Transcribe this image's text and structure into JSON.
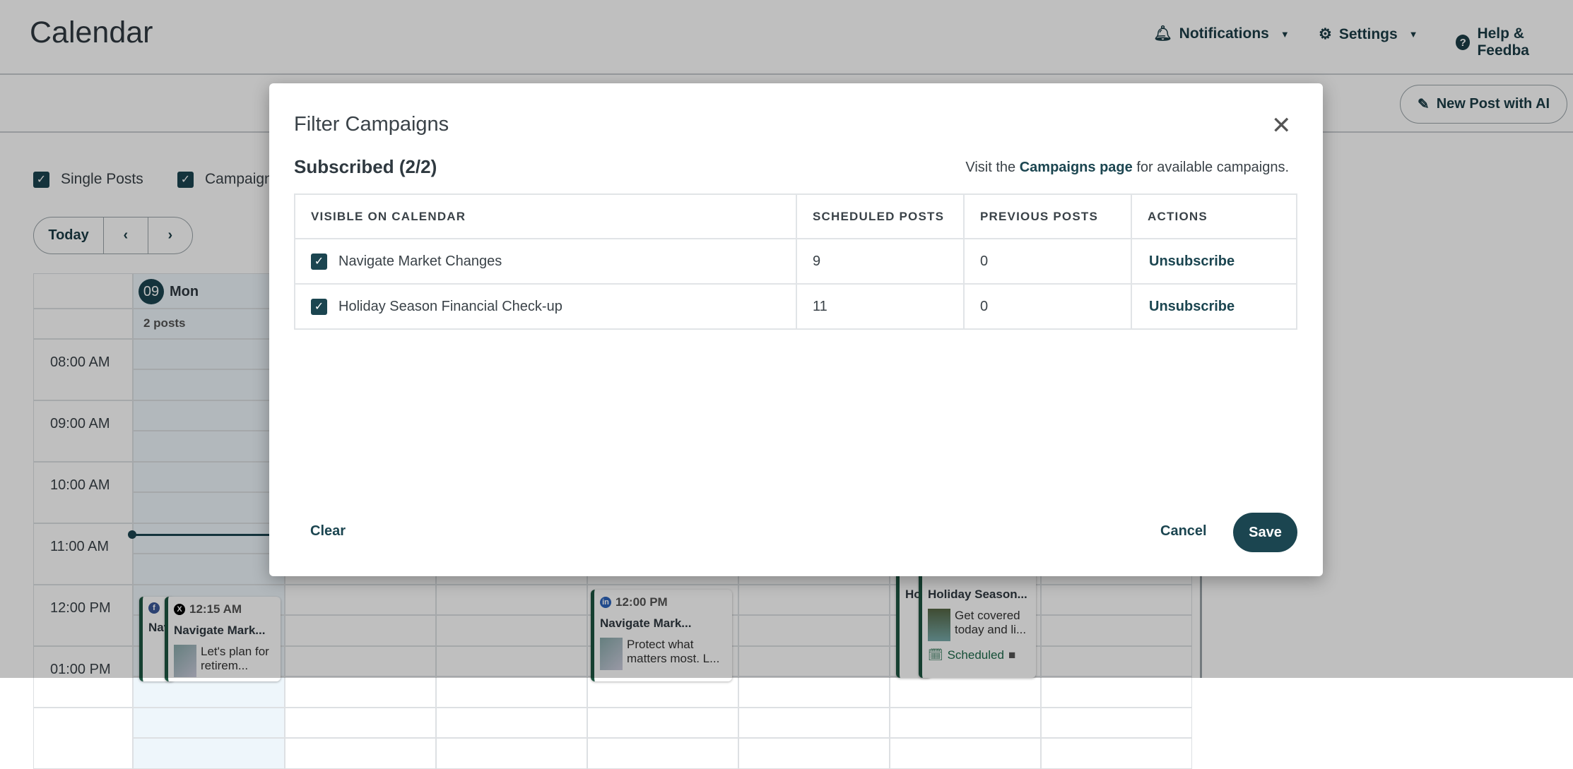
{
  "header": {
    "title": "Calendar",
    "notifications": "Notifications",
    "settings": "Settings",
    "help": "Help & Feedba"
  },
  "toolbar": {
    "new_post": "New Post with AI"
  },
  "filters": {
    "single_posts": "Single Posts",
    "campaigns": "Campaign"
  },
  "nav": {
    "today": "Today",
    "prev": "‹",
    "next": "›"
  },
  "calendar": {
    "day_num": "09",
    "day_name": "Mon",
    "posts_count": "2 posts",
    "times": [
      "08:00 AM",
      "09:00 AM",
      "10:00 AM",
      "11:00 AM",
      "12:00 PM",
      "01:00 PM"
    ],
    "posts": [
      {
        "time": "12:15 AM",
        "title": "Navigate Mark...",
        "text": "Let's plan for retirem...",
        "network": "X"
      },
      {
        "title": "Nav",
        "network": "f"
      },
      {
        "time": "12:00 PM",
        "title": "Navigate Mark...",
        "text": "Protect what matters most. L...",
        "network": "in"
      },
      {
        "title": "Holiday Season...",
        "text": "Get covered today and li...",
        "status": "Scheduled"
      },
      {
        "title": "Ho"
      }
    ]
  },
  "modal": {
    "title": "Filter Campaigns",
    "subscribed": "Subscribed (2/2)",
    "hint_pre": "Visit the ",
    "hint_link": "Campaigns page",
    "hint_post": " for available campaigns.",
    "columns": [
      "VISIBLE ON CALENDAR",
      "SCHEDULED POSTS",
      "PREVIOUS POSTS",
      "ACTIONS"
    ],
    "rows": [
      {
        "name": "Navigate Market Changes",
        "scheduled": "9",
        "previous": "0",
        "action": "Unsubscribe",
        "checked": true
      },
      {
        "name": "Holiday Season Financial Check-up",
        "scheduled": "11",
        "previous": "0",
        "action": "Unsubscribe",
        "checked": true
      }
    ],
    "clear": "Clear",
    "cancel": "Cancel",
    "save": "Save"
  },
  "colors": {
    "primary": "#1b4550",
    "post_accent": "#1d5540"
  }
}
